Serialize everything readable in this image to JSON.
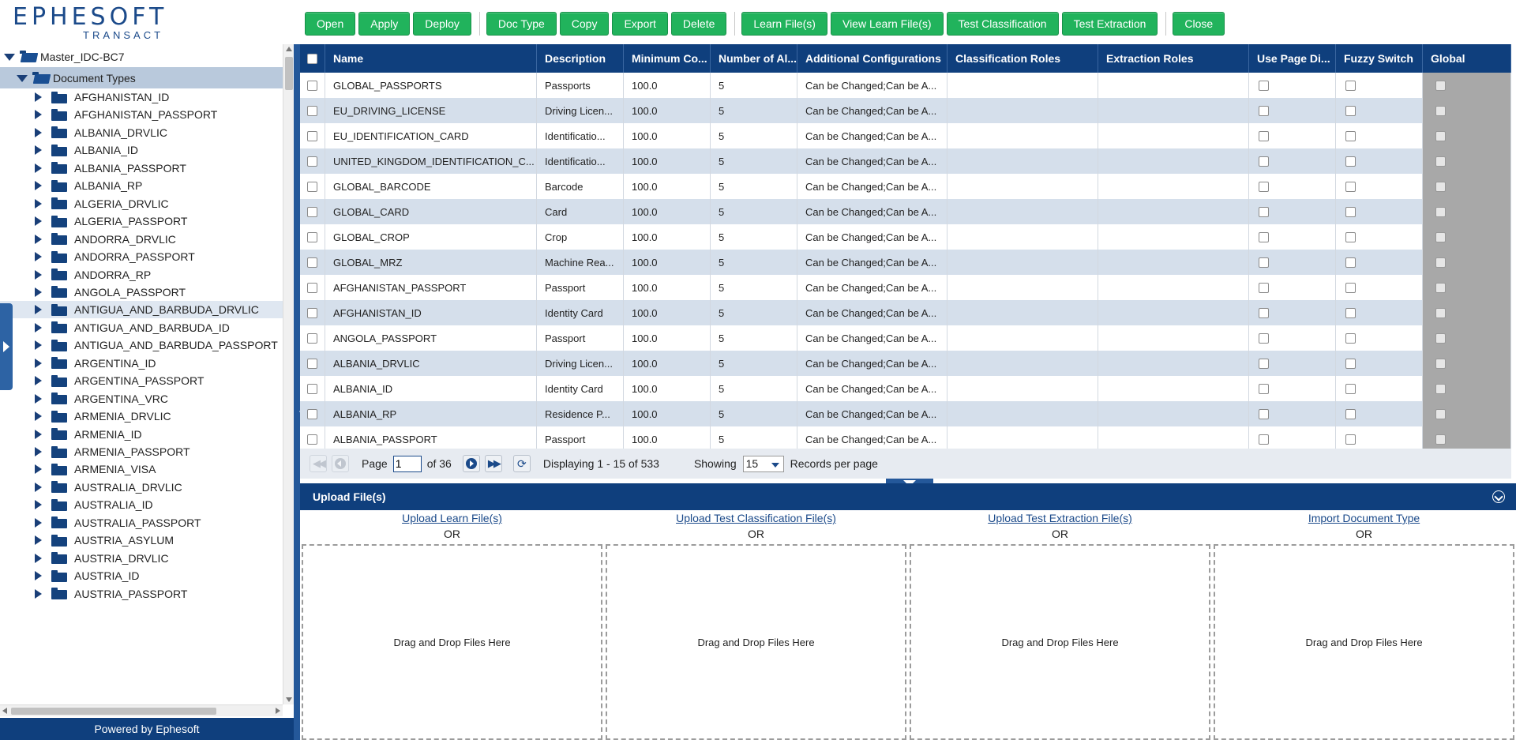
{
  "logo": {
    "brand": "EPHESOFT",
    "sub": "TRANSACT"
  },
  "toolbar": {
    "open": "Open",
    "apply": "Apply",
    "deploy": "Deploy",
    "doc_type": "Doc Type",
    "copy": "Copy",
    "export": "Export",
    "delete": "Delete",
    "learn_files": "Learn File(s)",
    "view_learn_files": "View Learn File(s)",
    "test_classification": "Test Classification",
    "test_extraction": "Test Extraction",
    "close": "Close"
  },
  "tree": {
    "root": "Master_IDC-BC7",
    "document_types": "Document Types",
    "items": [
      "AFGHANISTAN_ID",
      "AFGHANISTAN_PASSPORT",
      "ALBANIA_DRVLIC",
      "ALBANIA_ID",
      "ALBANIA_PASSPORT",
      "ALBANIA_RP",
      "ALGERIA_DRVLIC",
      "ALGERIA_PASSPORT",
      "ANDORRA_DRVLIC",
      "ANDORRA_PASSPORT",
      "ANDORRA_RP",
      "ANGOLA_PASSPORT",
      "ANTIGUA_AND_BARBUDA_DRVLIC",
      "ANTIGUA_AND_BARBUDA_ID",
      "ANTIGUA_AND_BARBUDA_PASSPORT",
      "ARGENTINA_ID",
      "ARGENTINA_PASSPORT",
      "ARGENTINA_VRC",
      "ARMENIA_DRVLIC",
      "ARMENIA_ID",
      "ARMENIA_PASSPORT",
      "ARMENIA_VISA",
      "AUSTRALIA_DRVLIC",
      "AUSTRALIA_ID",
      "AUSTRALIA_PASSPORT",
      "AUSTRIA_ASYLUM",
      "AUSTRIA_DRVLIC",
      "AUSTRIA_ID",
      "AUSTRIA_PASSPORT"
    ]
  },
  "footer": "Powered by Ephesoft",
  "grid": {
    "columns": [
      "Name",
      "Description",
      "Minimum Co...",
      "Number of Al...",
      "Additional Configurations",
      "Classification Roles",
      "Extraction Roles",
      "Use Page Di...",
      "Fuzzy Switch",
      "Global"
    ],
    "rows": [
      [
        "GLOBAL_PASSPORTS",
        "Passports",
        "100.0",
        "5",
        "Can be Changed;Can be A..."
      ],
      [
        "EU_DRIVING_LICENSE",
        "Driving Licen...",
        "100.0",
        "5",
        "Can be Changed;Can be A..."
      ],
      [
        "EU_IDENTIFICATION_CARD",
        "Identificatio...",
        "100.0",
        "5",
        "Can be Changed;Can be A..."
      ],
      [
        "UNITED_KINGDOM_IDENTIFICATION_C...",
        "Identificatio...",
        "100.0",
        "5",
        "Can be Changed;Can be A..."
      ],
      [
        "GLOBAL_BARCODE",
        "Barcode",
        "100.0",
        "5",
        "Can be Changed;Can be A..."
      ],
      [
        "GLOBAL_CARD",
        "Card",
        "100.0",
        "5",
        "Can be Changed;Can be A..."
      ],
      [
        "GLOBAL_CROP",
        "Crop",
        "100.0",
        "5",
        "Can be Changed;Can be A..."
      ],
      [
        "GLOBAL_MRZ",
        "Machine Rea...",
        "100.0",
        "5",
        "Can be Changed;Can be A..."
      ],
      [
        "AFGHANISTAN_PASSPORT",
        "Passport",
        "100.0",
        "5",
        "Can be Changed;Can be A..."
      ],
      [
        "AFGHANISTAN_ID",
        "Identity Card",
        "100.0",
        "5",
        "Can be Changed;Can be A..."
      ],
      [
        "ANGOLA_PASSPORT",
        "Passport",
        "100.0",
        "5",
        "Can be Changed;Can be A..."
      ],
      [
        "ALBANIA_DRVLIC",
        "Driving Licen...",
        "100.0",
        "5",
        "Can be Changed;Can be A..."
      ],
      [
        "ALBANIA_ID",
        "Identity Card",
        "100.0",
        "5",
        "Can be Changed;Can be A..."
      ],
      [
        "ALBANIA_RP",
        "Residence P...",
        "100.0",
        "5",
        "Can be Changed;Can be A..."
      ],
      [
        "ALBANIA_PASSPORT",
        "Passport",
        "100.0",
        "5",
        "Can be Changed;Can be A..."
      ]
    ]
  },
  "pager": {
    "page_label": "Page",
    "page_value": "1",
    "of_label": "of 36",
    "displaying": "Displaying 1 - 15 of 533",
    "showing_label": "Showing",
    "per_page": "15",
    "records_label": "Records per page"
  },
  "upload": {
    "title": "Upload File(s)",
    "or": "OR",
    "drop": "Drag and Drop Files Here",
    "links": [
      "Upload Learn File(s)",
      "Upload Test Classification File(s)",
      "Upload Test Extraction File(s)",
      "Import Document Type"
    ]
  }
}
